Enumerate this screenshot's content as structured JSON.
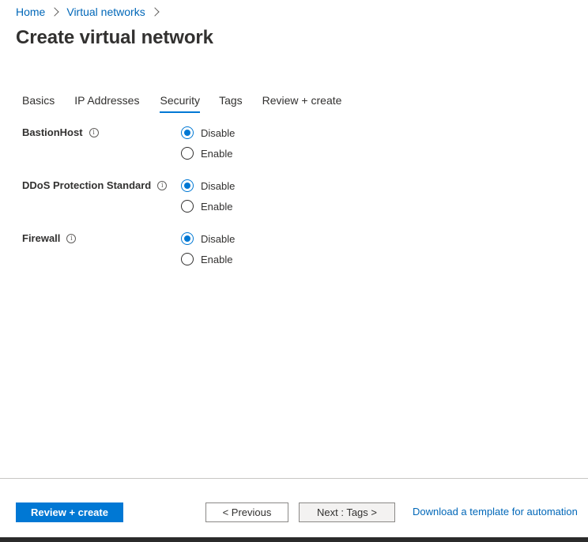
{
  "breadcrumb": {
    "items": [
      "Home",
      "Virtual networks"
    ]
  },
  "page": {
    "title": "Create virtual network"
  },
  "tabs": [
    {
      "label": "Basics",
      "active": false
    },
    {
      "label": "IP Addresses",
      "active": false
    },
    {
      "label": "Security",
      "active": true
    },
    {
      "label": "Tags",
      "active": false
    },
    {
      "label": "Review + create",
      "active": false
    }
  ],
  "security": {
    "rows": [
      {
        "label": "BastionHost",
        "options": [
          "Disable",
          "Enable"
        ],
        "selected": "Disable"
      },
      {
        "label": "DDoS Protection Standard",
        "options": [
          "Disable",
          "Enable"
        ],
        "selected": "Disable"
      },
      {
        "label": "Firewall",
        "options": [
          "Disable",
          "Enable"
        ],
        "selected": "Disable"
      }
    ]
  },
  "footer": {
    "review_create_label": "Review + create",
    "previous_label": "< Previous",
    "next_label": "Next : Tags >",
    "download_link": "Download a template for automation"
  },
  "colors": {
    "accent": "#0078d4",
    "link": "#0067b8"
  },
  "icons": {
    "info": "info-icon",
    "separator": "chevron-right-icon"
  }
}
